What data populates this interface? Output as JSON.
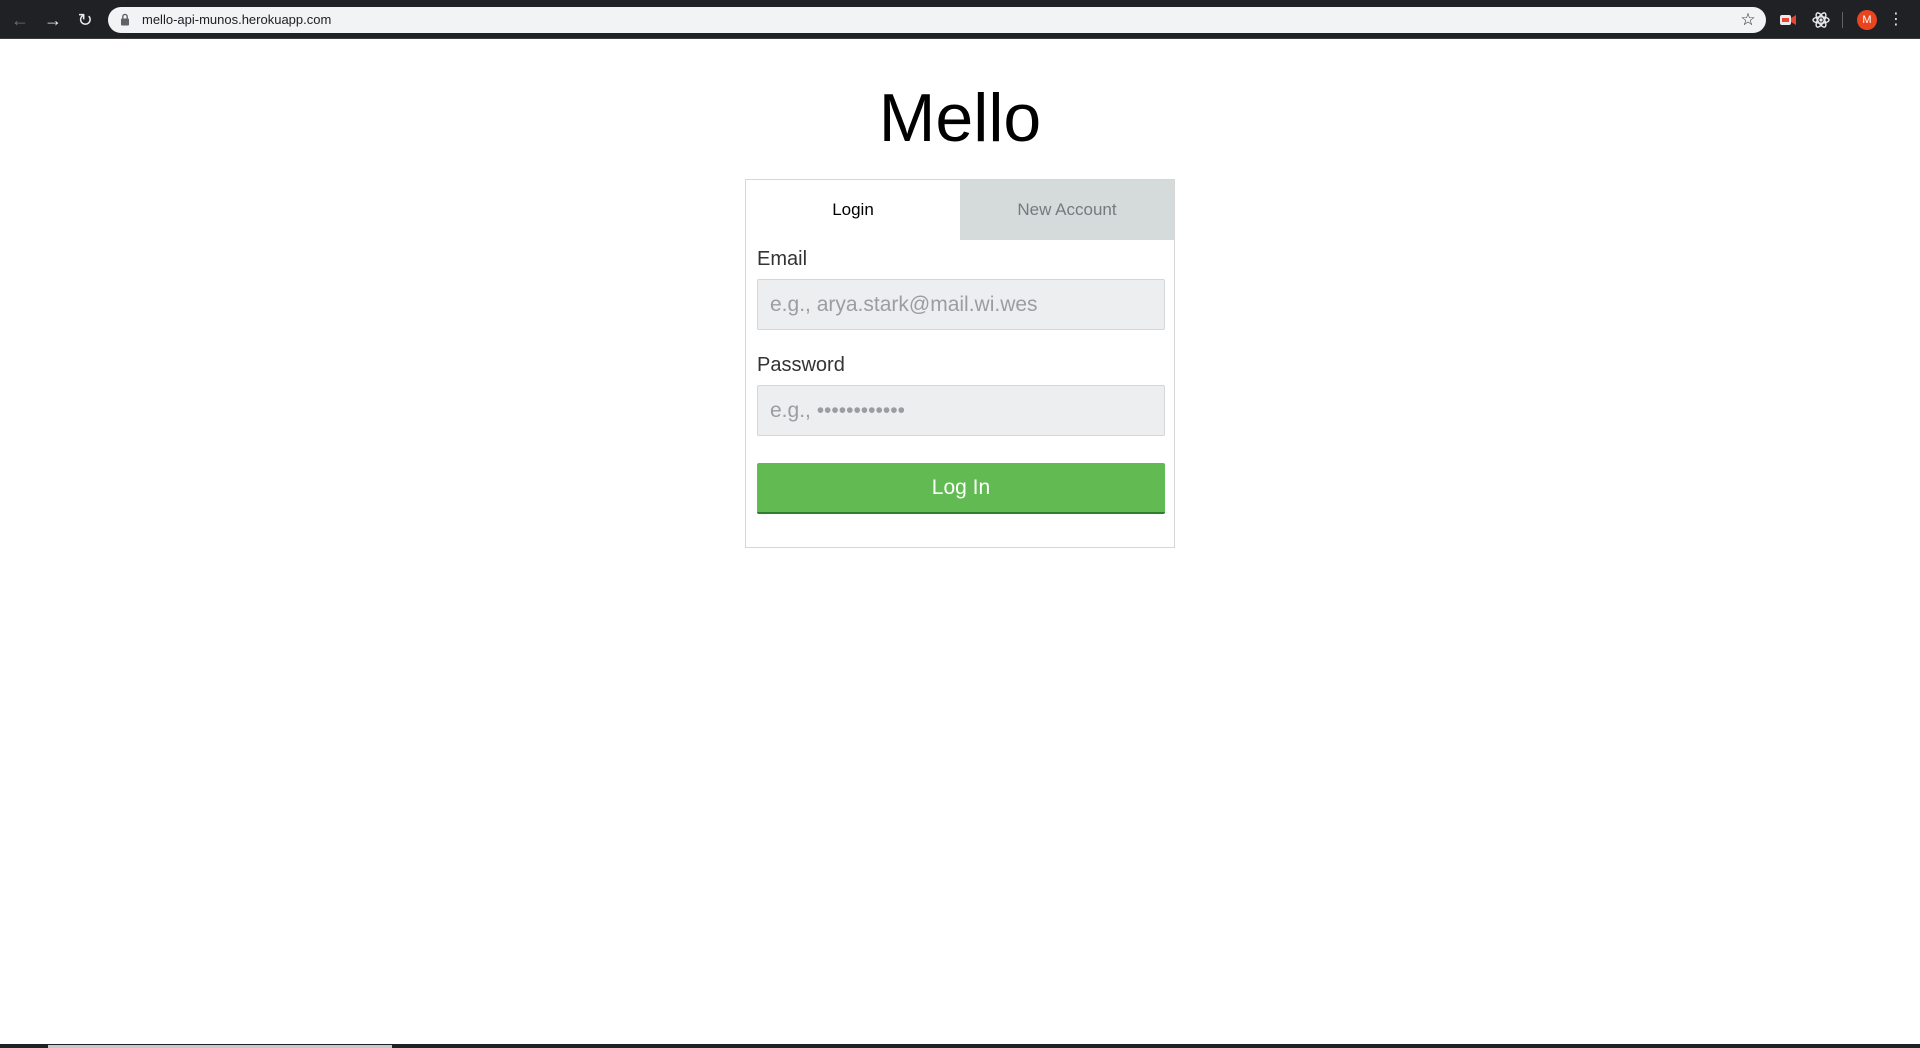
{
  "browser": {
    "url": "mello-api-munos.herokuapp.com",
    "avatar_initial": "M",
    "icons": {
      "back": "arrow-left-icon",
      "forward": "arrow-right-icon",
      "reload": "reload-icon",
      "lock": "lock-icon",
      "bookmark": "star-icon",
      "extension_1": "video-extension-icon",
      "extension_2": "react-devtools-icon",
      "menu": "kebab-menu-icon"
    }
  },
  "page": {
    "title": "Mello"
  },
  "auth": {
    "tabs": [
      {
        "label": "Login",
        "active": true
      },
      {
        "label": "New Account",
        "active": false
      }
    ],
    "email": {
      "label": "Email",
      "value": "",
      "placeholder": "e.g., arya.stark@mail.wi.wes"
    },
    "password": {
      "label": "Password",
      "value": "",
      "placeholder": "e.g., ••••••••••••"
    },
    "submit_label": "Log In"
  },
  "colors": {
    "chrome_dark": "#202124",
    "omnibox_bg": "#f1f3f4",
    "active_tab_bg": "#ffffff",
    "inactive_tab_bg": "#d5dbdb",
    "inactive_tab_text": "#737b7d",
    "input_bg": "#edeeef",
    "button_green": "#61bb52",
    "button_border": "#2f7e2f",
    "avatar_bg": "#e8441d"
  }
}
